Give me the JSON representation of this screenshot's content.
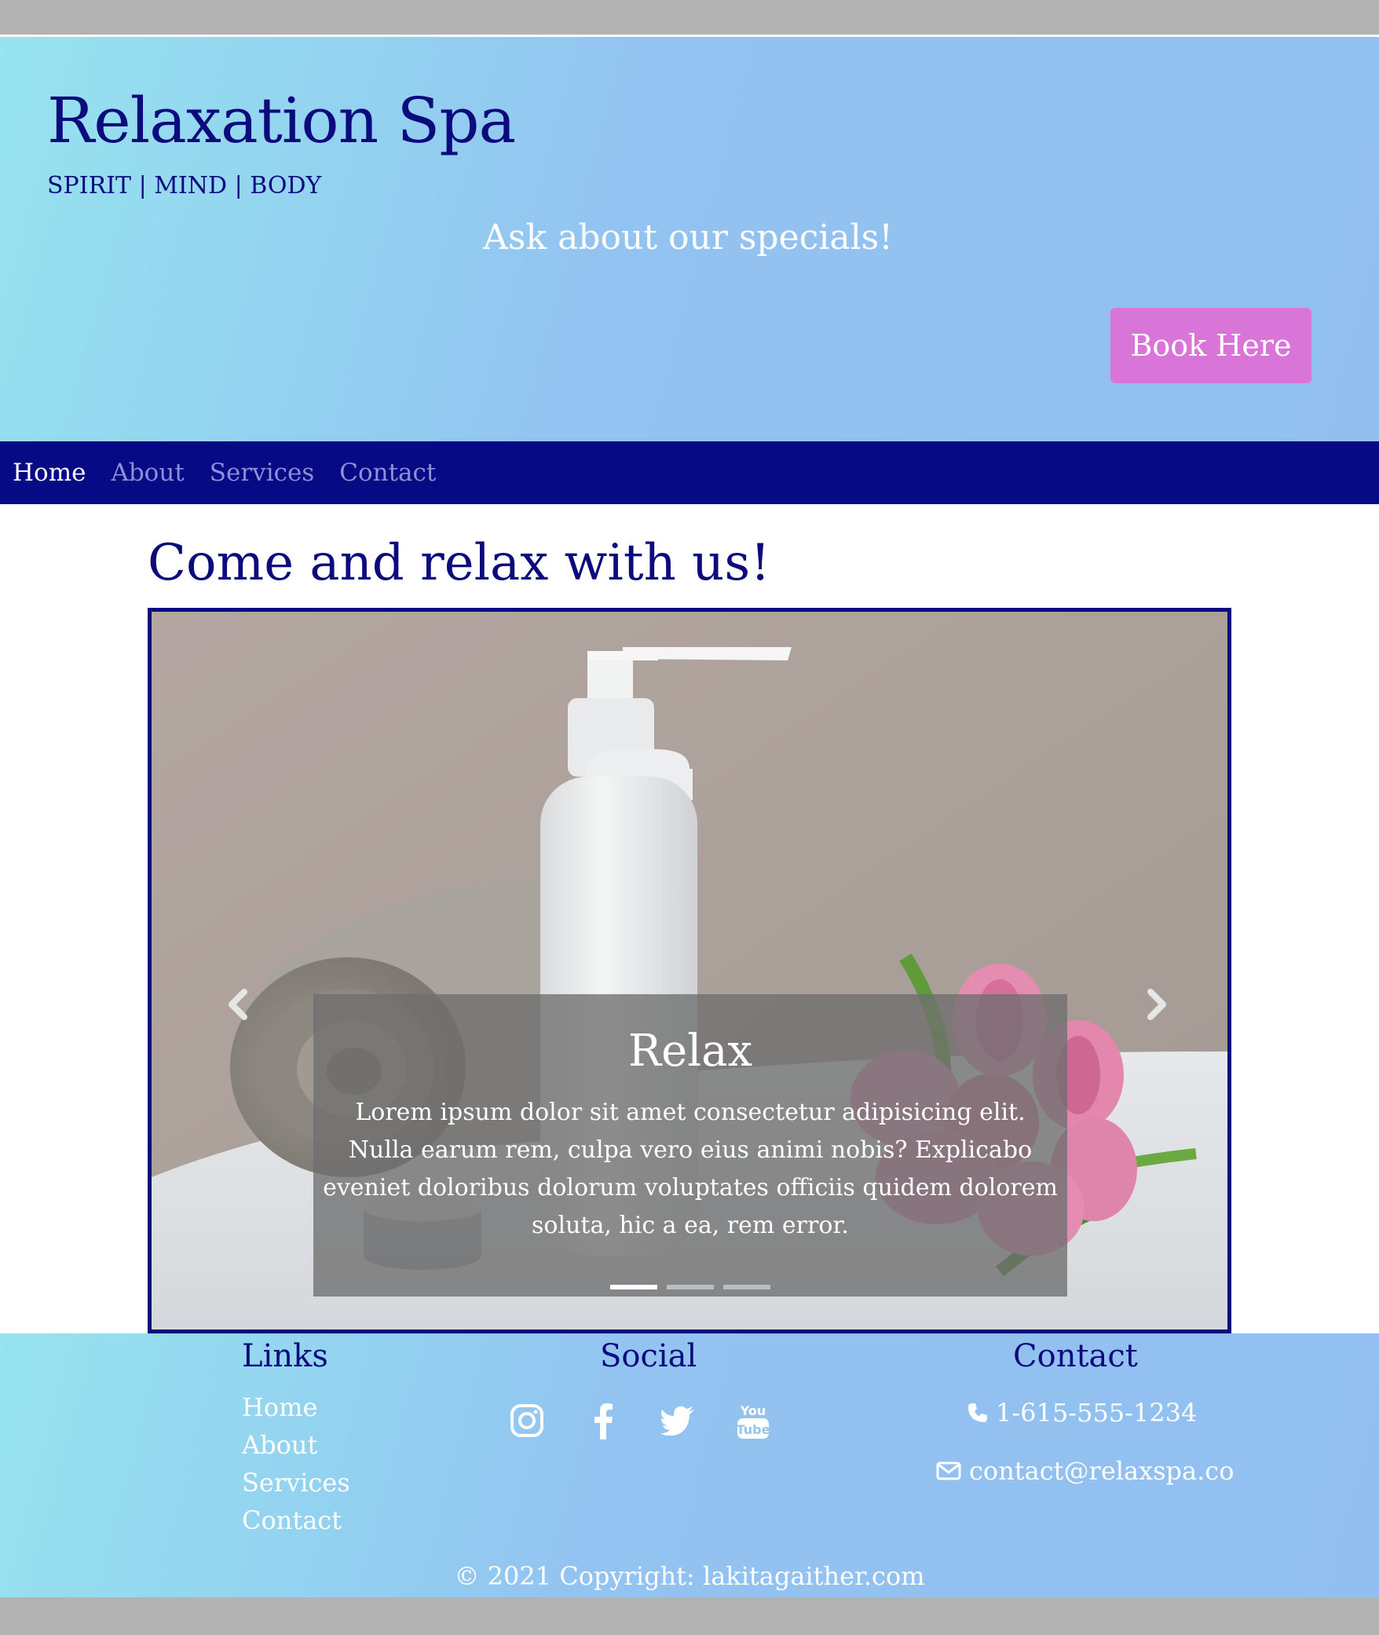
{
  "header": {
    "title": "Relaxation Spa",
    "tagline": "SPIRIT | MIND | BODY",
    "specials": "Ask about our specials!",
    "book_button": "Book Here"
  },
  "nav": {
    "items": [
      {
        "label": "Home",
        "active": true
      },
      {
        "label": "About",
        "active": false
      },
      {
        "label": "Services",
        "active": false
      },
      {
        "label": "Contact",
        "active": false
      }
    ]
  },
  "main": {
    "heading": "Come and relax with us!"
  },
  "carousel": {
    "caption_title": "Relax",
    "caption_text": "Lorem ipsum dolor sit amet consectetur adipisicing elit. Nulla earum rem, culpa vero eius animi nobis? Explicabo eveniet doloribus dolorum voluptates officiis quidem dolorem soluta, hic a ea, rem error.",
    "slide_count": 3,
    "active_slide": 1,
    "prev_icon": "chevron-left-icon",
    "next_icon": "chevron-right-icon"
  },
  "footer": {
    "links_heading": "Links",
    "links": [
      "Home",
      "About",
      "Services",
      "Contact"
    ],
    "social_heading": "Social",
    "social_icons": [
      "instagram-icon",
      "facebook-icon",
      "twitter-icon",
      "youtube-icon"
    ],
    "contact_heading": "Contact",
    "phone": "1-615-555-1234",
    "email": "contact@relaxspa.co",
    "copyright": "© 2021 Copyright: lakitagaither.com"
  },
  "colors": {
    "brand_navy": "#0b0b7e",
    "nav_bg": "#060a85",
    "button_pink": "#d974d9",
    "header_gradient_start": "#97e3ef",
    "header_gradient_end": "#92bff0"
  }
}
